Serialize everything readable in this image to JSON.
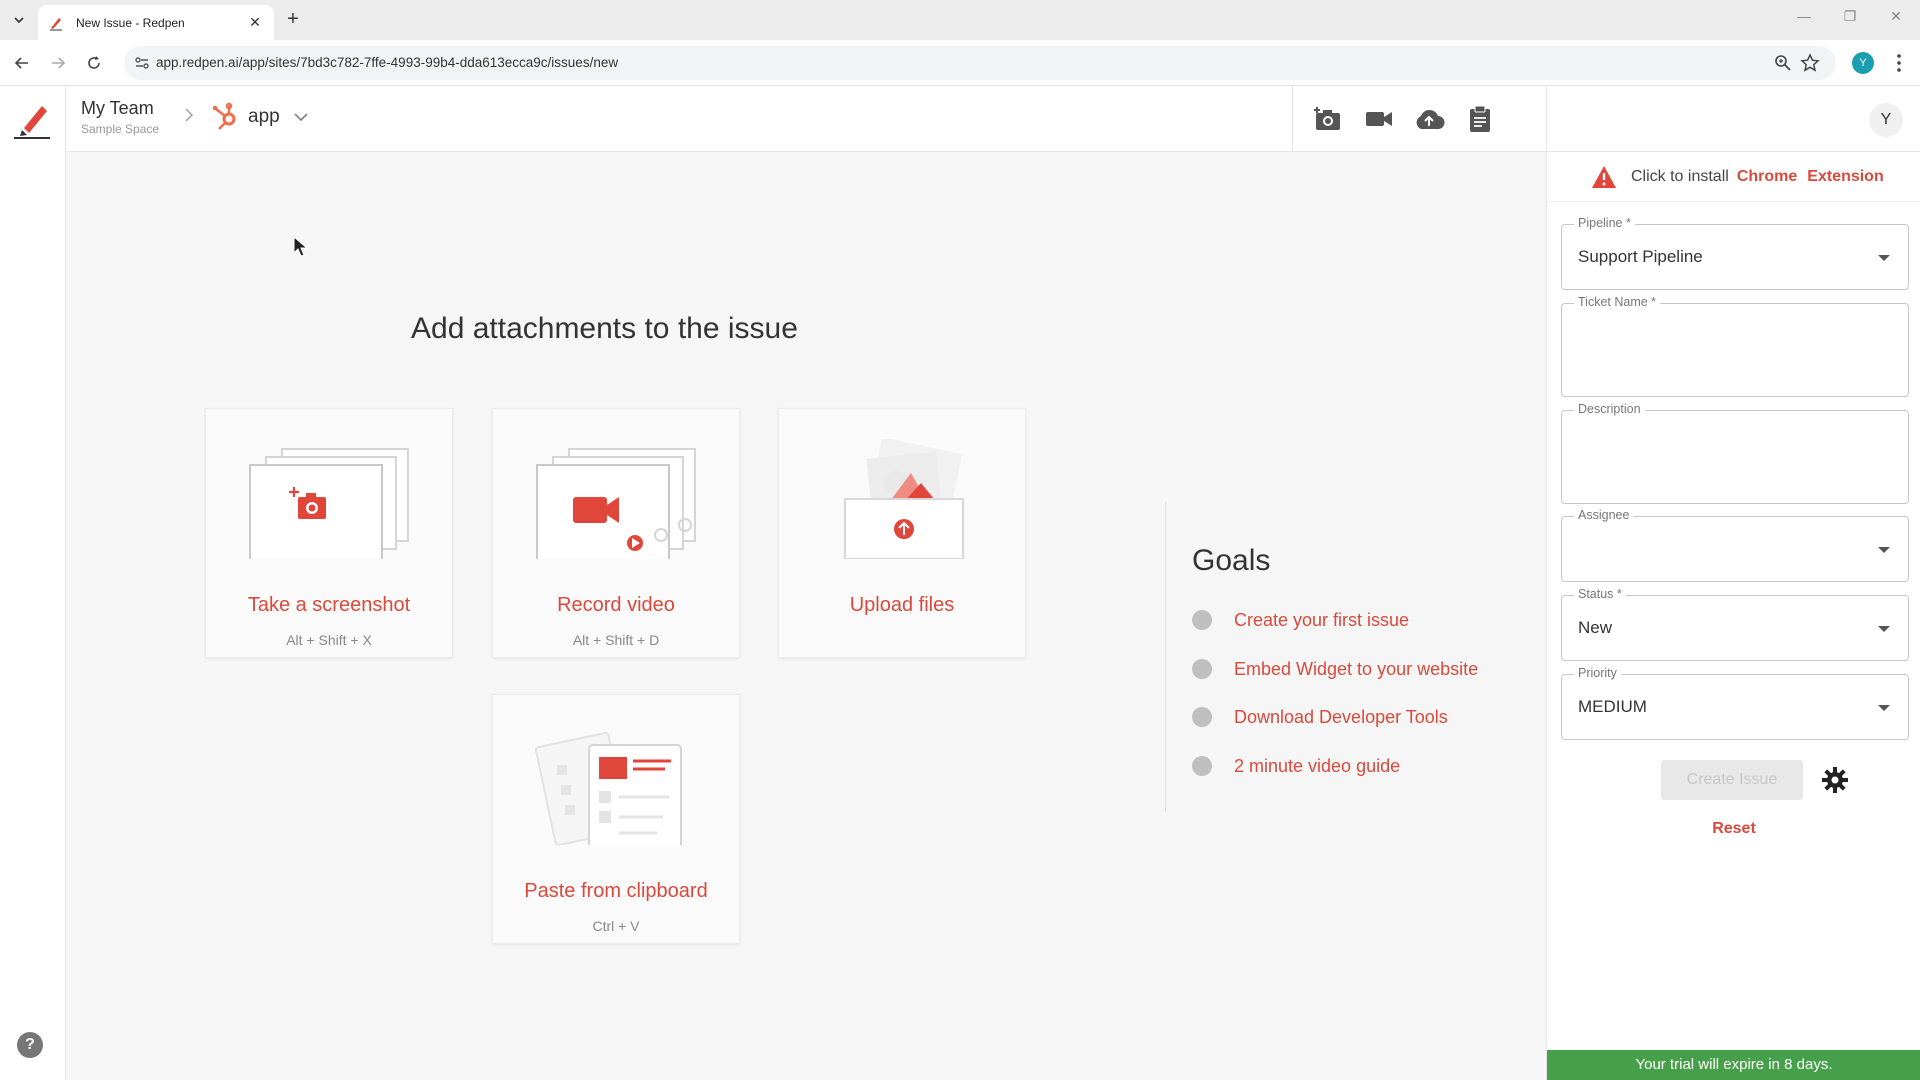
{
  "browser": {
    "tab_title": "New Issue - Redpen",
    "url": "app.redpen.ai/app/sites/7bd3c782-7ffe-4993-99b4-dda613ecca9c/issues/new",
    "profile_initial": "Y"
  },
  "header": {
    "team_name": "My Team",
    "team_sub": "Sample Space",
    "project_name": "app"
  },
  "main": {
    "title": "Add attachments to the issue",
    "cards": [
      {
        "label": "Take a screenshot",
        "hint": "Alt + Shift + X"
      },
      {
        "label": "Record video",
        "hint": "Alt + Shift + D"
      },
      {
        "label": "Upload files",
        "hint": ""
      },
      {
        "label": "Paste from clipboard",
        "hint": "Ctrl + V"
      }
    ],
    "goals_title": "Goals",
    "goals": [
      "Create your first issue",
      "Embed Widget to your website",
      "Download Developer Tools",
      "2 minute video guide"
    ]
  },
  "panel": {
    "avatar_initial": "Y",
    "install_text": "Click to install",
    "install_link_1": "Chrome",
    "install_link_2": "Extension",
    "fields": {
      "pipeline_label": "Pipeline *",
      "pipeline_value": "Support Pipeline",
      "ticket_label": "Ticket Name *",
      "ticket_value": "",
      "description_label": "Description",
      "description_value": "",
      "assignee_label": "Assignee",
      "assignee_value": "",
      "status_label": "Status *",
      "status_value": "New",
      "priority_label": "Priority",
      "priority_value": "MEDIUM"
    },
    "create_button": "Create Issue",
    "reset_label": "Reset",
    "trial_banner": "Your trial will expire in 8 days."
  },
  "colors": {
    "accent": "#d94a3d",
    "trial_green": "#46a049"
  }
}
